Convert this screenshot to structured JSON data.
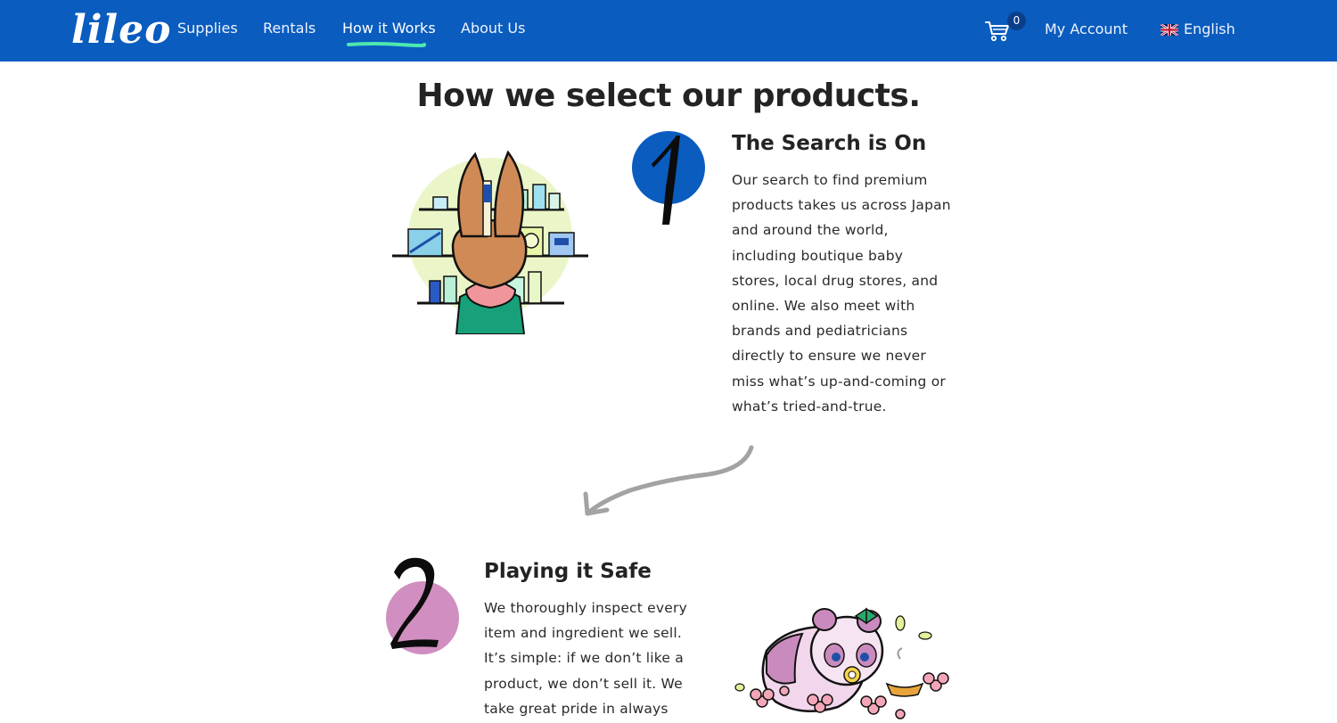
{
  "nav": {
    "logo": "lileo",
    "items": [
      "Supplies",
      "Rentals",
      "How it Works",
      "About Us"
    ],
    "active_index": 2,
    "cart_count": "0",
    "account_label": "My Account",
    "language_label": "English",
    "icons": {
      "cart": "cart-icon",
      "flag": "uk-flag-icon"
    }
  },
  "page": {
    "title": "How we select our products."
  },
  "steps": [
    {
      "number": "1",
      "heading": "The Search is On",
      "body": "Our search to find premium products takes us across Japan and around the world, including boutique baby stores, local drug stores, and online. We also meet with brands and pediatricians directly to ensure we never miss what’s up-and-coming or what’s tried-and-true.",
      "circle_color": "#0a5cbf",
      "illustration": "bunny-shopping-illustration"
    },
    {
      "number": "2",
      "heading": "Playing it Safe",
      "body": "We thoroughly inspect every item and ingredient we sell. It’s simple: if we don’t like a product, we don’t sell it. We take great pride in always",
      "circle_color": "#d08fc0",
      "illustration": "panda-flowers-illustration"
    }
  ],
  "colors": {
    "nav_bg": "#0a5cbf",
    "active_underline": "#4de8b0",
    "text": "#232323"
  }
}
